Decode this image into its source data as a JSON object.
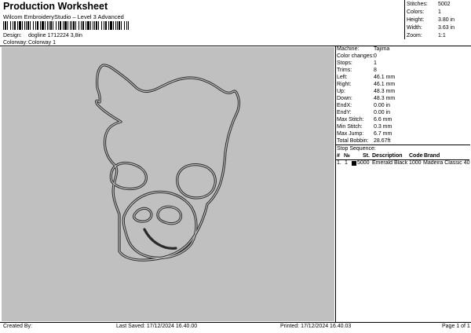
{
  "header": {
    "title": "Production Worksheet",
    "subtitle": "Wilcom EmbroideryStudio – Level 3 Advanced",
    "design_label": "Design:",
    "design_value": "dogline 1712224 3,8in",
    "colorway_label": "Colorway:",
    "colorway_value": "Colorway 1"
  },
  "summary": [
    {
      "key": "Stitches:",
      "value": "5002"
    },
    {
      "key": "Colors:",
      "value": "1"
    },
    {
      "key": "Height:",
      "value": "3.80 in"
    },
    {
      "key": "Width:",
      "value": "3.63 in"
    },
    {
      "key": "Zoom:",
      "value": "1:1"
    }
  ],
  "machine_info": [
    {
      "key": "Machine:",
      "value": "Tajima"
    },
    {
      "key": "Color changes:",
      "value": "0"
    },
    {
      "key": "Stops:",
      "value": "1"
    },
    {
      "key": "Trims:",
      "value": "8"
    },
    {
      "key": "Left:",
      "value": "46.1 mm"
    },
    {
      "key": "Right:",
      "value": "46.1 mm"
    },
    {
      "key": "Up:",
      "value": "48.3 mm"
    },
    {
      "key": "Down:",
      "value": "48.3 mm"
    },
    {
      "key": "EndX:",
      "value": "0.00 in"
    },
    {
      "key": "EndY:",
      "value": "0.00 in"
    },
    {
      "key": "Max Stitch:",
      "value": "6.6 mm"
    },
    {
      "key": "Min Stitch:",
      "value": "0.3 mm"
    },
    {
      "key": "Max Jump:",
      "value": "6.7 mm"
    },
    {
      "key": "Total Bobbin:",
      "value": "28.67ft"
    }
  ],
  "stop_sequence": {
    "title": "Stop Sequence:",
    "headers": [
      "#",
      "№",
      "St.",
      "Description",
      "Code",
      "Brand"
    ],
    "rows": [
      {
        "num": "1.",
        "no": "1",
        "stitches": "5000",
        "description": "Emerald Black",
        "code": "1000",
        "brand": "Madeira Classic 40",
        "color": "#000000"
      }
    ]
  },
  "footer": {
    "created_by": "Created By:",
    "last_saved": "Last Saved: 17/12/2024 16.40.00",
    "printed": "Printed: 17/12/2024 16.40.03",
    "page": "Page 1 of 1"
  },
  "colors": {
    "canvas_bg": "#c0c0c0",
    "stitch": "#2a2a2a"
  }
}
